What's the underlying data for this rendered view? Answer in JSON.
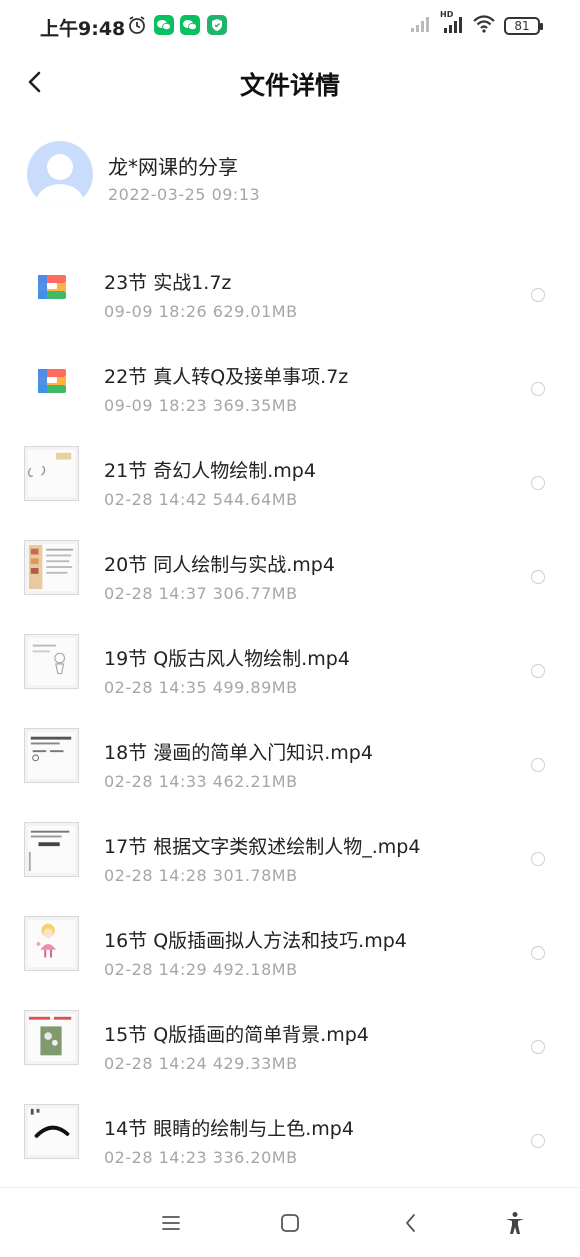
{
  "status_bar": {
    "time": "上午9:48",
    "battery": "81",
    "network_label": "HD"
  },
  "header": {
    "title": "文件详情"
  },
  "sharer": {
    "name": "龙*网课的分享",
    "date": "2022-03-25  09:13"
  },
  "files": [
    {
      "name": "23节  实战1.7z",
      "meta": "09-09  18:26  629.01MB",
      "type": "archive"
    },
    {
      "name": "22节 真人转Q及接单事项.7z",
      "meta": "09-09  18:23  369.35MB",
      "type": "archive"
    },
    {
      "name": "21节  奇幻人物绘制.mp4",
      "meta": "02-28  14:42  544.64MB",
      "type": "video"
    },
    {
      "name": "20节 同人绘制与实战.mp4",
      "meta": "02-28  14:37  306.77MB",
      "type": "video"
    },
    {
      "name": "19节 Q版古风人物绘制.mp4",
      "meta": "02-28  14:35  499.89MB",
      "type": "video"
    },
    {
      "name": "18节  漫画的简单入门知识.mp4",
      "meta": "02-28  14:33  462.21MB",
      "type": "video"
    },
    {
      "name": "17节  根据文字类叙述绘制人物_.mp4",
      "meta": "02-28  14:28  301.78MB",
      "type": "video"
    },
    {
      "name": "16节 Q版插画拟人方法和技巧.mp4",
      "meta": "02-28  14:29  492.18MB",
      "type": "video"
    },
    {
      "name": "15节 Q版插画的简单背景.mp4",
      "meta": "02-28  14:24  429.33MB",
      "type": "video"
    },
    {
      "name": "14节  眼睛的绘制与上色.mp4",
      "meta": "02-28  14:23  336.20MB",
      "type": "video"
    }
  ],
  "colors": {
    "meta_text": "#a6a6a6",
    "avatar_bg": "#c9dcfb",
    "wechat_green": "#07c160",
    "shield_green": "#1fb36b"
  }
}
